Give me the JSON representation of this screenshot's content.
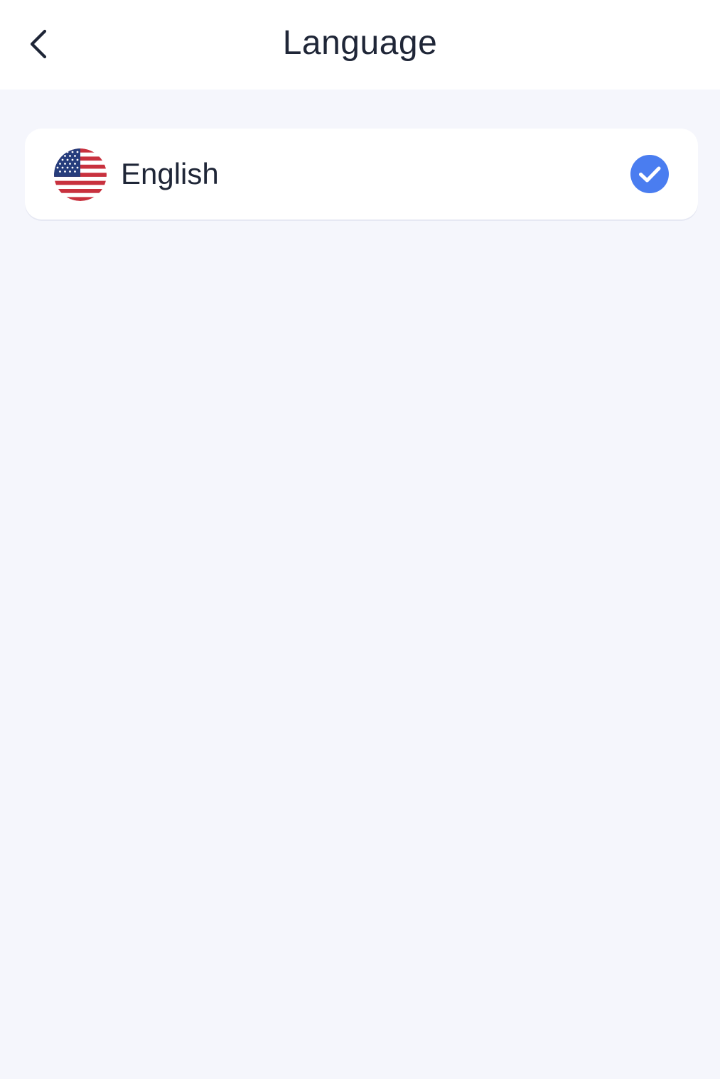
{
  "header": {
    "title": "Language",
    "back_icon": "chevron-left-icon"
  },
  "languages": [
    {
      "label": "English",
      "flag_icon": "us-flag-icon",
      "selected": true
    }
  ],
  "colors": {
    "background": "#F5F6FC",
    "card": "#FFFFFF",
    "text": "#1F2637",
    "accent": "#4A7DF0"
  }
}
